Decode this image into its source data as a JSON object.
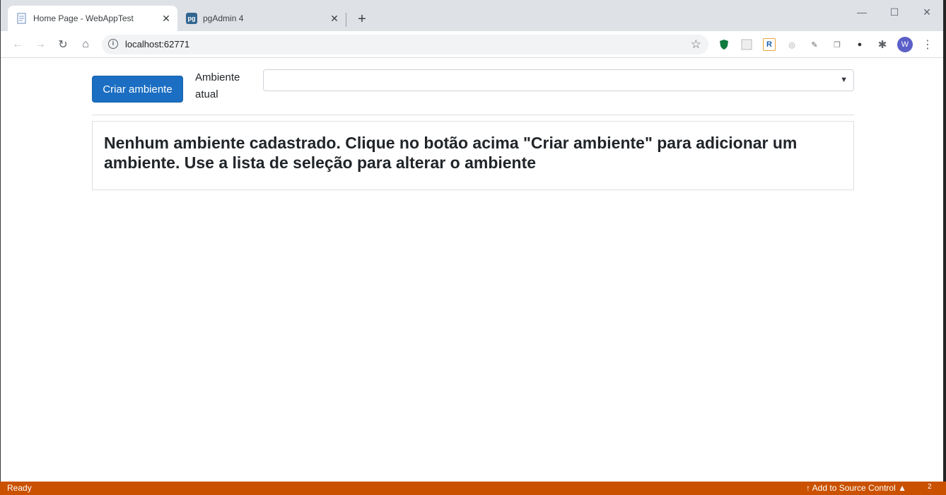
{
  "browser": {
    "tabs": [
      {
        "title": "Home Page - WebAppTest",
        "favicon": "page-icon",
        "active": true
      },
      {
        "title": "pgAdmin 4",
        "favicon": "pgadmin-icon",
        "favicon_text": "pg",
        "active": false
      }
    ],
    "address": {
      "url": "localhost:62771"
    },
    "profile_initial": "W",
    "colors": {
      "tabstrip": "#dee1e6",
      "accent": "#1b6ec2"
    }
  },
  "page": {
    "create_button_label": "Criar ambiente",
    "env_label": "Ambiente atual",
    "env_select_value": "",
    "empty_message": "Nenhum ambiente cadastrado. Clique no botão acima \"Criar ambiente\" para adicionar um ambiente. Use a lista de seleção para alterar o ambiente"
  },
  "statusbar": {
    "status": "Ready",
    "source_control": "Add to Source Control",
    "notifications": "2",
    "color": "#ca5100"
  }
}
